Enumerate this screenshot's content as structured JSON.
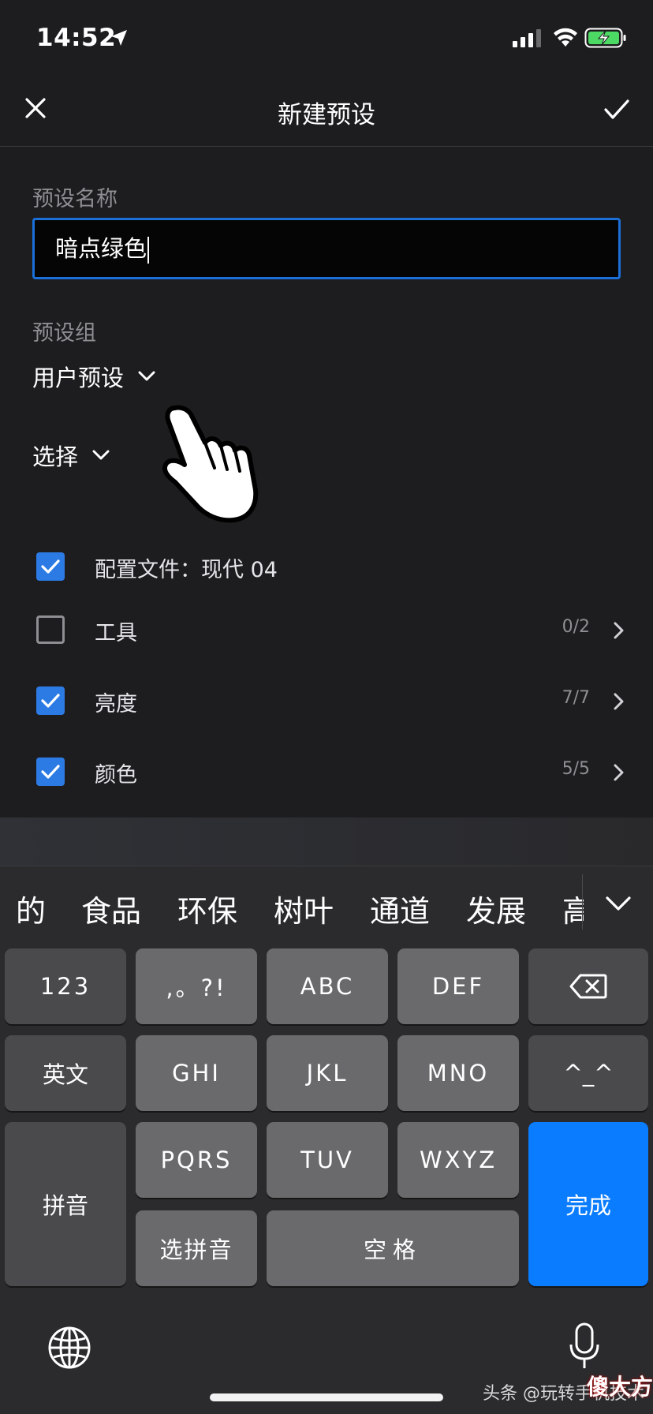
{
  "status_bar": {
    "time": "14:52"
  },
  "nav": {
    "title": "新建预设"
  },
  "form": {
    "name_label": "预设名称",
    "name_value": "暗点绿色",
    "group_label": "预设组",
    "group_value": "用户预设",
    "select_label": "选择"
  },
  "items": [
    {
      "label": "配置文件：现代 04",
      "checked": true,
      "count": ""
    },
    {
      "label": "工具",
      "checked": false,
      "count": "0/2"
    },
    {
      "label": "亮度",
      "checked": true,
      "count": "7/7"
    },
    {
      "label": "颜色",
      "checked": true,
      "count": "5/5"
    }
  ],
  "keyboard": {
    "candidates": [
      "的",
      "食品",
      "环保",
      "树叶",
      "通道",
      "发展",
      "高"
    ],
    "keys": {
      "numbers": "123",
      "punct": ",。?!",
      "abc": "ABC",
      "def": "DEF",
      "english": "英文",
      "ghi": "GHI",
      "jkl": "JKL",
      "mno": "MNO",
      "emoji": "^_^",
      "pinyin": "拼音",
      "pqrs": "PQRS",
      "tuv": "TUV",
      "wxyz": "WXYZ",
      "done": "完成",
      "select_pinyin": "选拼音",
      "space": "空格"
    }
  },
  "watermark": {
    "text": "头条 @玩转手机技术",
    "logo": "傻大方"
  },
  "colors": {
    "accent": "#2c7be5",
    "done_key": "#0a7cff",
    "background": "#1d1d1f"
  }
}
